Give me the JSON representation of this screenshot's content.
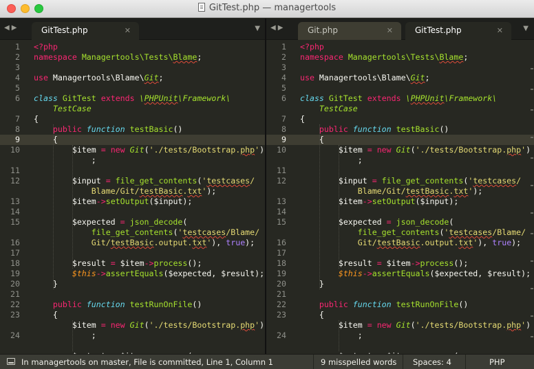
{
  "window": {
    "title": "GitTest.php — managertools"
  },
  "left_pane": {
    "tabs": [
      {
        "label": "GitTest.php",
        "active": true
      }
    ]
  },
  "right_pane": {
    "tabs": [
      {
        "label": "Git.php",
        "active": false
      },
      {
        "label": "GitTest.php",
        "active": true
      }
    ]
  },
  "editor": {
    "current_line": 9,
    "line_numbers": [
      "1",
      "2",
      "3",
      "4",
      "5",
      "6",
      "",
      "7",
      "8",
      "9",
      "10",
      "",
      "11",
      "12",
      "",
      "13",
      "14",
      "15",
      "",
      "16",
      "17",
      "18",
      "19",
      "20",
      "21",
      "22",
      "23",
      "",
      "24",
      ""
    ]
  },
  "status": {
    "info": "In managertools on master, File is committed, Line 1, Column 1",
    "spelling": "9 misspelled words",
    "spaces": "Spaces: 4",
    "syntax": "PHP"
  },
  "colors": {
    "background": "#272822",
    "keyword": "#f92672",
    "storage": "#66d9ef",
    "class": "#a6e22e",
    "string": "#e6db74",
    "constant": "#ae81ff",
    "variable_this": "#fd971f"
  }
}
